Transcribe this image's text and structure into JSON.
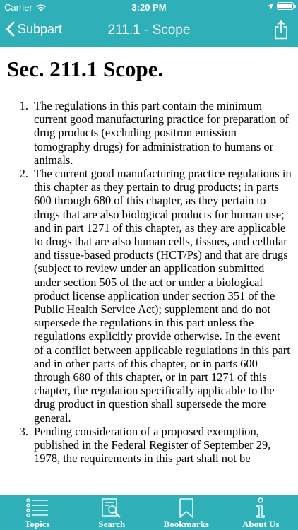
{
  "status_bar": {
    "carrier": "Carrier",
    "wifi_icon": "wifi-icon",
    "time": "3:20 PM",
    "location_icon": "location-arrow-icon",
    "battery_icon": "battery-full-icon"
  },
  "nav": {
    "back_label": "Subpart",
    "title": "211.1 - Scope",
    "share_icon": "share-icon"
  },
  "content": {
    "heading": "Sec. 211.1 Scope.",
    "items": [
      {
        "number": "1.",
        "text": "The regulations in this part contain the minimum current good manufacturing practice for preparation of drug products (excluding positron emission tomography drugs) for administration to humans or animals."
      },
      {
        "number": "2.",
        "text": "The current good manufacturing practice regulations in this chapter as they pertain to drug products; in parts 600 through 680 of this chapter, as they pertain to drugs that are also biological products for human use; and in part 1271 of this chapter, as they are applicable to drugs that are also human cells, tissues, and cellular and tissue-based products (HCT/Ps) and that are drugs (subject to review under an application submitted under section 505 of the act or under a biological product license application under section 351 of the Public Health Service Act); supplement and do not supersede the regulations in this part unless the regulations explicitly provide otherwise. In the event of a conflict between applicable regulations in this part and in other parts of this chapter, or in parts 600 through 680 of this chapter, or in part 1271 of this chapter, the regulation specifically applicable to the drug product in question shall supersede the more general."
      },
      {
        "number": "3.",
        "text": "Pending consideration of a proposed exemption, published in the Federal Register of September 29, 1978, the requirements in this part shall not be"
      }
    ]
  },
  "tabs": [
    {
      "label": "Topics",
      "icon": "list-icon"
    },
    {
      "label": "Search",
      "icon": "search-icon"
    },
    {
      "label": "Bookmarks",
      "icon": "bookmark-icon"
    },
    {
      "label": "About Us",
      "icon": "info-icon"
    }
  ],
  "colors": {
    "bar_background": "#2fb0b8",
    "bar_foreground": "#ffffff",
    "text": "#000000"
  }
}
